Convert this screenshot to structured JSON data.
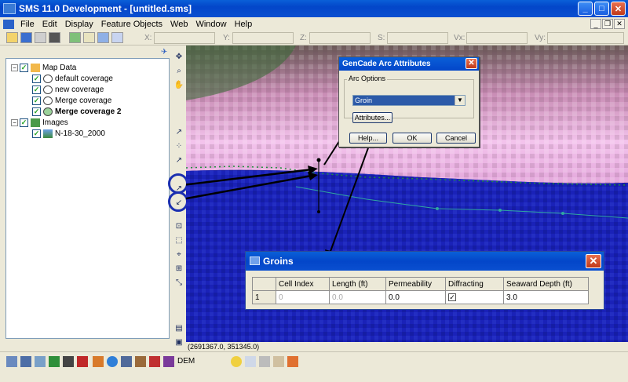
{
  "window": {
    "title": "SMS 11.0 Development - [untitled.sms]"
  },
  "menu": {
    "items": [
      "File",
      "Edit",
      "Display",
      "Feature Objects",
      "Web",
      "Window",
      "Help"
    ]
  },
  "coords": {
    "x_label": "X:",
    "y_label": "Y:",
    "z_label": "Z:",
    "s_label": "S:",
    "vx_label": "Vx:",
    "vy_label": "Vy:"
  },
  "tree": {
    "items": [
      {
        "label": "Map Data",
        "bold": false
      },
      {
        "label": "default coverage",
        "bold": false
      },
      {
        "label": "new coverage",
        "bold": false
      },
      {
        "label": "Merge coverage",
        "bold": false
      },
      {
        "label": "Merge coverage 2",
        "bold": true
      },
      {
        "label": "Images",
        "bold": false
      },
      {
        "label": "N-18-30_2000",
        "bold": false
      }
    ]
  },
  "status": {
    "coords": "(2691367.0, 351345.0)"
  },
  "bottom": {
    "dem_label": "DEM"
  },
  "gencade_dialog": {
    "title": "GenCade Arc Attributes",
    "group_label": "Arc Options",
    "arc_type": "Groin",
    "attributes_button": "Attributes...",
    "help_button": "Help...",
    "ok_button": "OK",
    "cancel_button": "Cancel"
  },
  "groins_dialog": {
    "title": "Groins",
    "columns": [
      "",
      "Cell Index",
      "Length (ft)",
      "Permeability",
      "Diffracting",
      "Seaward Depth (ft)"
    ],
    "row": {
      "index": "1",
      "cell_index": "0",
      "length": "0.0",
      "permeability": "0.0",
      "diffracting": "✓",
      "seaward_depth": "3.0"
    }
  },
  "colors": {
    "titlebar": "#0346c9",
    "ocean": "#1a22b8",
    "highlight": "#1b2fb0"
  }
}
